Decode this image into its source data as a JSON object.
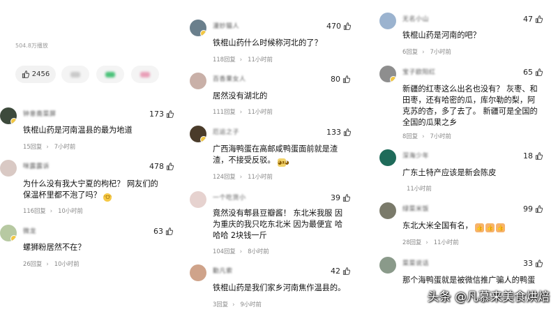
{
  "colors": {
    "like_pill_bg": "#f2f2f2",
    "meta_text": "#888888",
    "body_text": "#111111",
    "badge": "#f2c744"
  },
  "icons": {
    "like": "thumbs-up-icon",
    "reply_chevron": "chevron-right-icon",
    "laugh_emoji": "laughing-face-emoji",
    "doge_emoji": "doge-emoji",
    "thumbs_emoji": "thumbs-up-emoji"
  },
  "post": {
    "views": "504.8万播放",
    "like_count": "2456"
  },
  "columns": [
    {
      "comments": [
        {
          "username": "钟意斋菜屏",
          "likes": "173",
          "lines": [
            "铁棍山药是河南温县的最为地道"
          ],
          "replies": "15回复",
          "time": "7小时前",
          "avatar": "#3d4a3c"
        },
        {
          "username": "咪露露诉",
          "likes": "478",
          "lines": [
            "为什么没有我大宁夏的枸杞？ 网友们的",
            "保温杯里都不泡了吗？"
          ],
          "replies": "116回复",
          "time": "10小时前",
          "avatar": "#d9c9c4"
        },
        {
          "username": "微龙",
          "likes": "63",
          "lines": [
            "螺狮粉居然不在？"
          ],
          "replies": "26回复",
          "time": "10小时前",
          "avatar": "#b7c9a2"
        }
      ]
    },
    {
      "comments": [
        {
          "username": "漫妙猫人",
          "likes": "470",
          "lines": [
            "铁棍山药什么时候称河北的了？"
          ],
          "replies": "118回复",
          "time": "11小时前",
          "avatar": "#6a7f8c"
        },
        {
          "username": "百香果女人",
          "likes": "80",
          "lines": [
            "居然没有湖北的"
          ],
          "replies": "111回复",
          "time": "11小时前",
          "avatar": "#c9b0a8"
        },
        {
          "username": "厄运之子",
          "likes": "133",
          "lines": [
            "广西海鸭蛋在高邮咸鸭蛋面前就是渣",
            "渣，不接受反驳。"
          ],
          "replies": "124回复",
          "time": "11小时前",
          "avatar": "#4a3b2a"
        },
        {
          "username": "一个吃货小",
          "likes": "39",
          "lines": [
            "竟然没有郫县豆瓣酱！ 东北米我服 因",
            "为重庆的我只吃东北米 因为最便宜 哈",
            "哈哈 2块钱一斤"
          ],
          "replies": "104回复",
          "time": "8小时前",
          "avatar": "#e6d2cf"
        },
        {
          "username": "勤凡索",
          "likes": "42",
          "lines": [
            "铁棍山药是我们家乡河南焦作温县的。"
          ],
          "replies": "3回复",
          "time": "9小时前",
          "avatar": "#cfa38a"
        }
      ]
    },
    {
      "comments": [
        {
          "username": "无名小山",
          "likes": "47",
          "lines": [
            "铁棍山药是河南的吧？"
          ],
          "replies": "6回复",
          "time": "7小时前",
          "avatar": "#9bb3cf"
        },
        {
          "username": "宝子欧阳红",
          "likes": "65",
          "lines": [
            "新疆的红枣这么出名也没有？ 灰枣、和",
            "田枣，还有哈密的瓜，库尔勒的梨，阿",
            "克苏的杏，多了去了。 新疆可是全国的",
            "全国的瓜果之乡"
          ],
          "replies": "8回复",
          "time": "7小时前",
          "avatar": "#8e8e8e"
        },
        {
          "username": "深海少年",
          "likes": "18",
          "lines": [
            "广东土特产应该是新会陈皮"
          ],
          "replies": "",
          "time": "11小时前",
          "avatar": "#1f6b5a"
        },
        {
          "username": "绿菜米饭",
          "likes": "99",
          "lines": [
            "东北大米全国有名，"
          ],
          "replies": "28回复",
          "time": "11小时前",
          "avatar": "#7a7a6a"
        },
        {
          "username": "菜菜说话",
          "likes": "33",
          "lines": [
            "那个海鸭蛋就是被微信推广骗人的鸭蛋"
          ],
          "replies": "",
          "time": "",
          "avatar": "#8a9a8a"
        }
      ]
    }
  ],
  "watermark": "头条 @凡慕来美食烘焙"
}
